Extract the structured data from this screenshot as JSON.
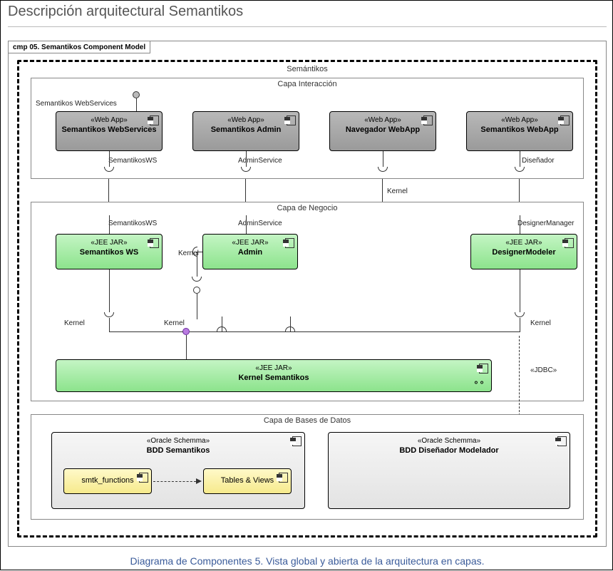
{
  "page": {
    "title": "Descripción arquitectural Semantikos",
    "caption": "Diagrama de Componentes 5. Vista global y abierta de la arquitectura en capas."
  },
  "diagram": {
    "frame_label": "cmp 05. Semantikos Component Model",
    "system_name": "Semántikos",
    "layers": {
      "interaction": {
        "title": "Capa Interacción"
      },
      "business": {
        "title": "Capa de Negocio"
      },
      "data": {
        "title": "Capa de Bases de Datos"
      }
    },
    "stereotypes": {
      "webapp": "«Web App»",
      "jeejar": "«JEE JAR»",
      "oracle": "«Oracle Schemma»",
      "jdbc": "«JDBC»"
    },
    "components": {
      "ws_webapp": {
        "name": "Semantikos WebServices"
      },
      "admin_webapp": {
        "name": "Semantikos Admin"
      },
      "nav_webapp": {
        "name": "Navegador WebApp"
      },
      "sem_webapp": {
        "name": "Semantikos WebApp"
      },
      "ws_jar": {
        "name": "Semantikos WS"
      },
      "admin_jar": {
        "name": "Admin"
      },
      "designer_jar": {
        "name": "DesignerModeler"
      },
      "kernel": {
        "name": "Kernel Semantikos"
      },
      "bdd_sem": {
        "name": "BDD Semantikos"
      },
      "bdd_dis": {
        "name": "BDD Diseñador Modelador"
      },
      "smtk_fn": {
        "name": "smtk_functions"
      },
      "tables": {
        "name": "Tables & Views"
      }
    },
    "interface_labels": {
      "semws": "SemantikosWS",
      "adminsvc": "AdminService",
      "designer": "Diseñador",
      "designer_mgr": "DesignerManager",
      "kernel": "Kernel",
      "ws_port": "Semantikos WebServices"
    }
  }
}
